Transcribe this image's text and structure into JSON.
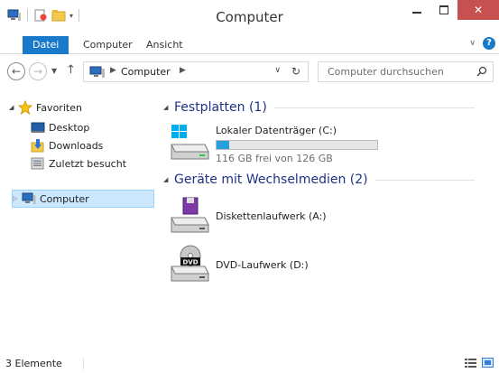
{
  "window": {
    "title": "Computer"
  },
  "ribbon": {
    "tabs": [
      "Datei",
      "Computer",
      "Ansicht"
    ]
  },
  "address": {
    "crumb": "Computer",
    "search_placeholder": "Computer durchsuchen"
  },
  "nav": {
    "favorites": "Favoriten",
    "items": [
      "Desktop",
      "Downloads",
      "Zuletzt besucht"
    ],
    "computer": "Computer"
  },
  "content": {
    "groups": [
      "Festplatten (1)",
      "Geräte mit Wechselmedien (2)"
    ],
    "drives": [
      {
        "name": "Lokaler Datenträger (C:)",
        "free_text": "116 GB frei von 126 GB",
        "used_fraction": 0.08
      },
      {
        "name": "Diskettenlaufwerk (A:)"
      },
      {
        "name": "DVD-Laufwerk (D:)"
      }
    ]
  },
  "status": {
    "count": "3 Elemente"
  },
  "colors": {
    "accent": "#1979ca",
    "selection": "#cce8ff",
    "group_title": "#1e3287",
    "progress": "#26a0da"
  }
}
